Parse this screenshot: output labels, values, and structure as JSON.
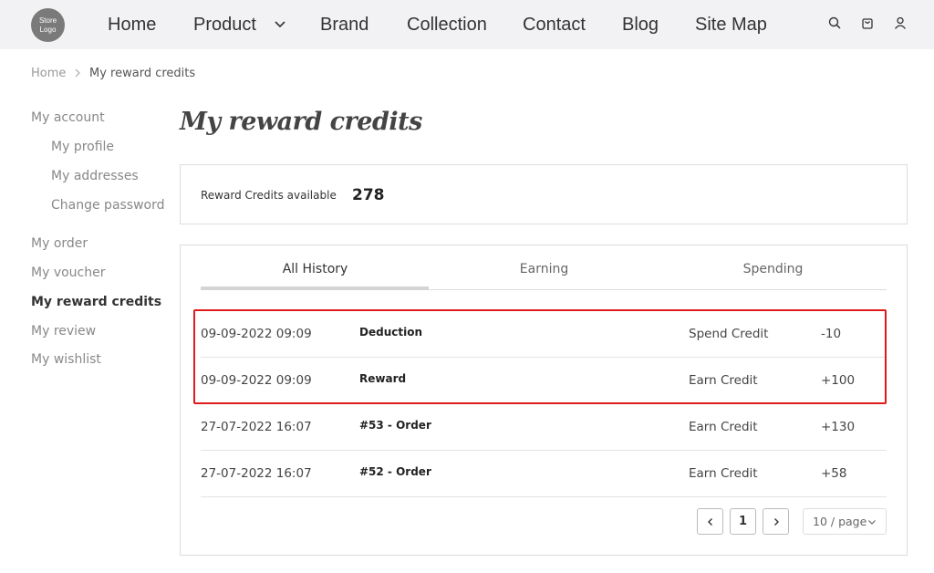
{
  "header": {
    "logo_text": "Store Logo",
    "nav": [
      "Home",
      "Product",
      "Brand",
      "Collection",
      "Contact",
      "Blog",
      "Site Map"
    ],
    "icons": [
      "search-icon",
      "cart-icon",
      "user-icon"
    ]
  },
  "breadcrumb": {
    "home": "Home",
    "current": "My reward credits"
  },
  "sidebar": {
    "items": [
      "My account",
      "My profile",
      "My addresses",
      "Change password",
      "My order",
      "My voucher",
      "My reward credits",
      "My review",
      "My wishlist"
    ],
    "active": "My reward credits"
  },
  "page": {
    "title": "My reward credits",
    "credits_label": "Reward Credits available",
    "credits_value": "278"
  },
  "tabs": {
    "labels": [
      "All History",
      "Earning",
      "Spending"
    ],
    "active": "All History"
  },
  "history": [
    {
      "date": "09-09-2022 09:09",
      "description": "Deduction",
      "type": "Spend Credit",
      "amount": "-10"
    },
    {
      "date": "09-09-2022 09:09",
      "description": "Reward",
      "type": "Earn Credit",
      "amount": "+100"
    },
    {
      "date": "27-07-2022 16:07",
      "description": "#53 - Order",
      "type": "Earn Credit",
      "amount": "+130"
    },
    {
      "date": "27-07-2022 16:07",
      "description": "#52 - Order",
      "type": "Earn Credit",
      "amount": "+58"
    }
  ],
  "pagination": {
    "current_page": "1",
    "page_size": "10 / page"
  },
  "colors": {
    "highlight": "#e01b1b",
    "header_bg": "#f2f2f4"
  }
}
